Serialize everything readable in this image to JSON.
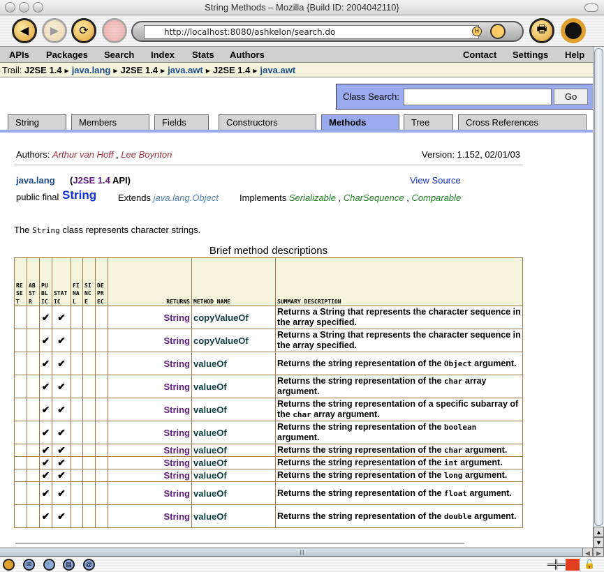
{
  "window": {
    "title": "String Methods – Mozilla {Build ID: 2004042110}"
  },
  "toolbar": {
    "url": "http://localhost:8080/ashkelon/search.do"
  },
  "nav": {
    "left": [
      "APIs",
      "Packages",
      "Search",
      "Index",
      "Stats",
      "Authors"
    ],
    "right": [
      "Contact",
      "Settings",
      "Help"
    ]
  },
  "trail": {
    "label": "Trail:",
    "items": [
      {
        "text": "J2SE 1.4",
        "link": false
      },
      {
        "text": "java.lang",
        "link": true
      },
      {
        "text": "J2SE 1.4",
        "link": false
      },
      {
        "text": "java.awt",
        "link": true
      },
      {
        "text": "J2SE 1.4",
        "link": false
      },
      {
        "text": "java.awt",
        "link": true
      }
    ]
  },
  "search": {
    "label": "Class Search:",
    "value": "",
    "go": "Go"
  },
  "tabs": [
    "String",
    "Members",
    "Fields",
    "Constructors",
    "Methods",
    "Tree",
    "Cross References"
  ],
  "active_tab": "Methods",
  "class_info": {
    "authors_label": "Authors:",
    "authors": [
      "Arthur van Hoff",
      "Lee Boynton"
    ],
    "version": "Version: 1.152, 02/01/03",
    "package": "java.lang",
    "api_open": "(",
    "api": "J2SE 1.4",
    "api_close": "API)",
    "view_source": "View Source",
    "modifiers": "public final",
    "class_name": "String",
    "extends_label": "Extends",
    "extends": "java.lang.Object",
    "implements_label": "Implements",
    "implements": [
      "Serializable",
      "CharSequence",
      "Comparable"
    ],
    "desc_pre": "The",
    "desc_code": "String",
    "desc_post": "class represents character strings."
  },
  "table": {
    "caption": "Brief method descriptions",
    "headers": [
      "RESET",
      "ABSTR",
      "PUBLIC",
      "STATIC",
      "FINAL",
      "SINCE",
      "DEPREC",
      "RETURNS",
      "METHOD NAME",
      "SUMMARY DESCRIPTION"
    ],
    "check": "✔",
    "rows": [
      {
        "ret": "String",
        "name": "copyValueOf",
        "pre": "Returns a String that represents the character sequence in the array specified.",
        "code": "",
        "post": ""
      },
      {
        "ret": "String",
        "name": "copyValueOf",
        "pre": "Returns a String that represents the character sequence in the array specified.",
        "code": "",
        "post": ""
      },
      {
        "ret": "String",
        "name": "valueOf",
        "pre": "Returns the string representation of the ",
        "code": "Object",
        "post": " argument."
      },
      {
        "ret": "String",
        "name": "valueOf",
        "pre": "Returns the string representation of the ",
        "code": "char",
        "post": " array argument."
      },
      {
        "ret": "String",
        "name": "valueOf",
        "pre": "Returns the string representation of a specific subarray of the ",
        "code": "char",
        "post": " array argument."
      },
      {
        "ret": "String",
        "name": "valueOf",
        "pre": "Returns the string representation of the ",
        "code": "boolean",
        "post": " argument."
      },
      {
        "ret": "String",
        "name": "valueOf",
        "pre": "Returns the string representation of the ",
        "code": "char",
        "post": " argument."
      },
      {
        "ret": "String",
        "name": "valueOf",
        "pre": "Returns the string representation of the ",
        "code": "int",
        "post": " argument."
      },
      {
        "ret": "String",
        "name": "valueOf",
        "pre": "Returns the string representation of the ",
        "code": "long",
        "post": " argument."
      },
      {
        "ret": "String",
        "name": "valueOf",
        "pre": "Returns the string representation of the ",
        "code": "float",
        "post": " argument."
      },
      {
        "ret": "String",
        "name": "valueOf",
        "pre": "Returns the string representation of the ",
        "code": "double",
        "post": " argument."
      }
    ]
  }
}
